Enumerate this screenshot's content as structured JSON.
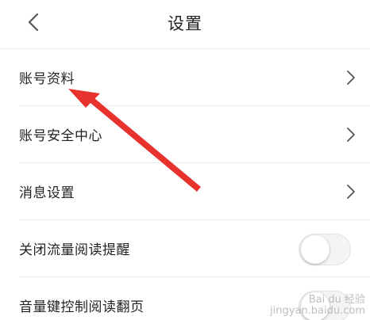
{
  "header": {
    "title": "设置",
    "back_icon": "chevron-left-icon"
  },
  "rows": [
    {
      "label": "账号资料",
      "control": "chevron"
    },
    {
      "label": "账号安全中心",
      "control": "chevron"
    },
    {
      "label": "消息设置",
      "control": "chevron"
    },
    {
      "label": "关闭流量阅读提醒",
      "control": "toggle",
      "on": false
    },
    {
      "label": "音量键控制阅读翻页",
      "control": "toggle",
      "on": false
    }
  ],
  "annotation": {
    "arrow_color": "#e8322e",
    "points_to": "账号资料"
  },
  "watermark": {
    "brand": "Bai du 经验",
    "site": "jingyan.baidu.com"
  },
  "colors": {
    "text": "#222222",
    "divider": "#ececec",
    "icon": "#555555"
  }
}
